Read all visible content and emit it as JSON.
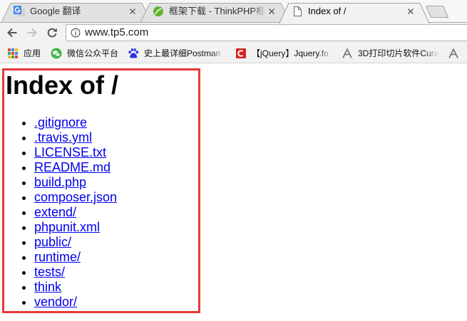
{
  "window": {
    "tabs": [
      {
        "title": "Google 翻译",
        "icon": "google-translate-icon",
        "active": false
      },
      {
        "title": "框架下载 - ThinkPHP框",
        "icon": "thinkphp-icon",
        "active": false
      },
      {
        "title": "Index of /",
        "icon": "document-icon",
        "active": true
      }
    ],
    "tab_close_icon": "close-icon",
    "new_tab_icon": "new-tab-icon"
  },
  "toolbar": {
    "back_icon": "back-arrow-icon",
    "forward_icon": "forward-arrow-icon",
    "forward_enabled": false,
    "reload_icon": "reload-icon",
    "address": {
      "security_icon": "info-icon",
      "url": "www.tp5.com"
    }
  },
  "bookmarks": [
    {
      "label": "应用",
      "icon": "apps-grid-icon"
    },
    {
      "label": "微信公众平台",
      "icon": "wechat-icon"
    },
    {
      "label": "史上最详细Postman",
      "icon": "baidu-paw-icon"
    },
    {
      "label": "【jQuery】Jquery.fo",
      "icon": "red-c-logo-icon"
    },
    {
      "label": "3D打印切片软件Cura",
      "icon": "a-logo-icon"
    },
    {
      "icon": "a-logo-icon"
    }
  ],
  "page": {
    "heading": "Index of /",
    "entries": [
      ".gitignore",
      ".travis.yml",
      "LICENSE.txt",
      "README.md",
      "build.php",
      "composer.json",
      "extend/",
      "phpunit.xml",
      "public/",
      "runtime/",
      "tests/",
      "think",
      "vendor/"
    ]
  },
  "annotation": {
    "highlight_color": "#e53935"
  },
  "colors": {
    "link": "#0000ee",
    "tab_active": "#f2f2f2",
    "tab_inactive": "#e2e2e2",
    "toolbar": "#f2f2f2",
    "page_background": "#ffffff"
  }
}
